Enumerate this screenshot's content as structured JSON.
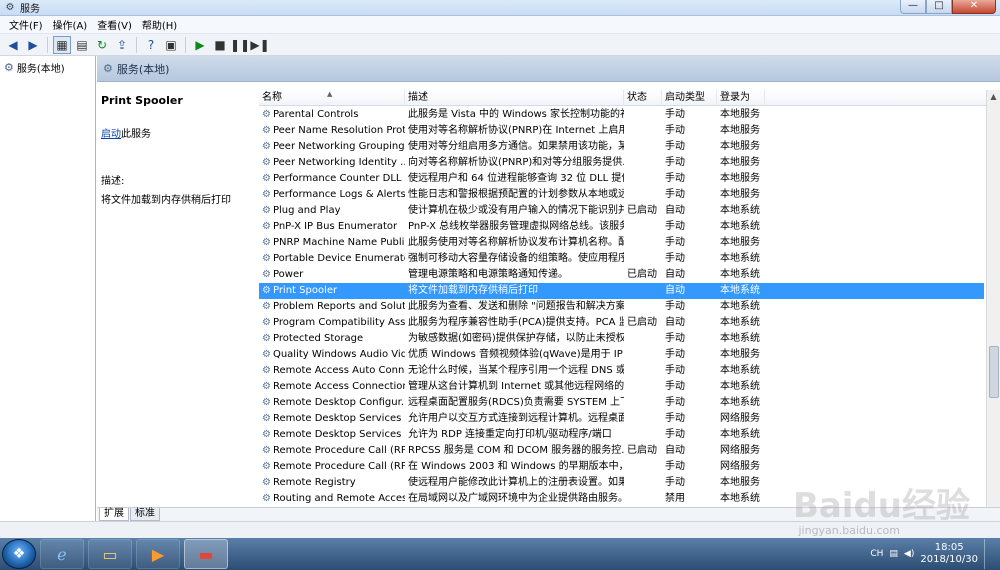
{
  "window": {
    "title": "服务"
  },
  "window_controls": {
    "minimize": "—",
    "maximize": "□",
    "close": "✕"
  },
  "menu": [
    "文件(F)",
    "操作(A)",
    "查看(V)",
    "帮助(H)"
  ],
  "tree": {
    "root_label": "服务(本地)"
  },
  "pane_header": "服务(本地)",
  "details": {
    "service_title": "Print Spooler",
    "start_link": "启动",
    "start_suffix": "此服务",
    "desc_label": "描述:",
    "desc_text": "将文件加载到内存供稍后打印"
  },
  "columns": [
    "名称",
    "描述",
    "状态",
    "启动类型",
    "登录为"
  ],
  "services": [
    {
      "name": "Parental Controls",
      "desc": "此服务是 Vista 中的 Windows 家长控制功能的补...",
      "status": "",
      "start": "手动",
      "logon": "本地服务"
    },
    {
      "name": "Peer Name Resolution Prot...",
      "desc": "使用对等名称解析协议(PNRP)在 Internet 上启用...",
      "status": "",
      "start": "手动",
      "logon": "本地服务"
    },
    {
      "name": "Peer Networking Grouping",
      "desc": "使用对等分组启用多方通信。如果禁用该功能，某...",
      "status": "",
      "start": "手动",
      "logon": "本地服务"
    },
    {
      "name": "Peer Networking Identity ...",
      "desc": "向对等名称解析协议(PNRP)和对等分组服务提供...",
      "status": "",
      "start": "手动",
      "logon": "本地服务"
    },
    {
      "name": "Performance Counter DLL ...",
      "desc": "使远程用户和 64 位进程能够查询 32 位 DLL 提供...",
      "status": "",
      "start": "手动",
      "logon": "本地服务"
    },
    {
      "name": "Performance Logs & Alerts",
      "desc": "性能日志和警报根据预配置的计划参数从本地或远...",
      "status": "",
      "start": "手动",
      "logon": "本地服务"
    },
    {
      "name": "Plug and Play",
      "desc": "使计算机在极少或没有用户输入的情况下能识别并...",
      "status": "已启动",
      "start": "自动",
      "logon": "本地系统"
    },
    {
      "name": "PnP-X IP Bus Enumerator",
      "desc": "PnP-X 总线枚举器服务管理虚拟网络总线。该服务...",
      "status": "",
      "start": "手动",
      "logon": "本地系统"
    },
    {
      "name": "PNRP Machine Name Publi...",
      "desc": "此服务使用对等名称解析协议发布计算机名称。配...",
      "status": "",
      "start": "手动",
      "logon": "本地服务"
    },
    {
      "name": "Portable Device Enumerato...",
      "desc": "强制可移动大容量存储设备的组策略。使应用程序...",
      "status": "",
      "start": "手动",
      "logon": "本地系统"
    },
    {
      "name": "Power",
      "desc": "管理电源策略和电源策略通知传递。",
      "status": "已启动",
      "start": "自动",
      "logon": "本地系统"
    },
    {
      "name": "Print Spooler",
      "desc": "将文件加载到内存供稍后打印",
      "status": "",
      "start": "自动",
      "logon": "本地系统",
      "selected": true
    },
    {
      "name": "Problem Reports and Solut...",
      "desc": "此服务为查看、发送和删除 \"问题报告和解决方案...",
      "status": "",
      "start": "手动",
      "logon": "本地系统"
    },
    {
      "name": "Program Compatibility Assi...",
      "desc": "此服务为程序兼容性助手(PCA)提供支持。PCA 监...",
      "status": "已启动",
      "start": "自动",
      "logon": "本地系统"
    },
    {
      "name": "Protected Storage",
      "desc": "为敏感数据(如密码)提供保护存储，以防止未授权...",
      "status": "",
      "start": "手动",
      "logon": "本地系统"
    },
    {
      "name": "Quality Windows Audio Vid...",
      "desc": "优质 Windows 音频视频体验(qWave)是用于 IP ...",
      "status": "",
      "start": "手动",
      "logon": "本地服务"
    },
    {
      "name": "Remote Access Auto Conn...",
      "desc": "无论什么时候，当某个程序引用一个远程 DNS 或...",
      "status": "",
      "start": "手动",
      "logon": "本地系统"
    },
    {
      "name": "Remote Access Connection...",
      "desc": "管理从这台计算机到 Internet 或其他远程网络的...",
      "status": "",
      "start": "手动",
      "logon": "本地系统"
    },
    {
      "name": "Remote Desktop Configur...",
      "desc": "远程桌面配置服务(RDCS)负责需要 SYSTEM 上下...",
      "status": "",
      "start": "手动",
      "logon": "本地系统"
    },
    {
      "name": "Remote Desktop Services",
      "desc": "允许用户以交互方式连接到远程计算机。远程桌面...",
      "status": "",
      "start": "手动",
      "logon": "网络服务"
    },
    {
      "name": "Remote Desktop Services ...",
      "desc": "允许为 RDP 连接重定向打印机/驱动程序/端口",
      "status": "",
      "start": "手动",
      "logon": "本地系统"
    },
    {
      "name": "Remote Procedure Call (RP...",
      "desc": "RPCSS 服务是 COM 和 DCOM 服务器的服务控...",
      "status": "已启动",
      "start": "自动",
      "logon": "网络服务"
    },
    {
      "name": "Remote Procedure Call (RP...",
      "desc": "在 Windows 2003 和 Windows 的早期版本中，...",
      "status": "",
      "start": "手动",
      "logon": "网络服务"
    },
    {
      "name": "Remote Registry",
      "desc": "使远程用户能修改此计算机上的注册表设置。如果...",
      "status": "",
      "start": "手动",
      "logon": "本地服务"
    },
    {
      "name": "Routing and Remote Access",
      "desc": "在局域网以及广域网环境中为企业提供路由服务。",
      "status": "",
      "start": "禁用",
      "logon": "本地系统"
    }
  ],
  "tabs": [
    "扩展",
    "标准"
  ],
  "tray": {
    "lang": "CH",
    "time": "18:05",
    "date": "2018/10/30"
  },
  "watermark": {
    "logo": "Baidu经验",
    "url": "jingyan.baidu.com"
  },
  "colors": {
    "selection": "#3399ff",
    "link": "#0645ad"
  }
}
